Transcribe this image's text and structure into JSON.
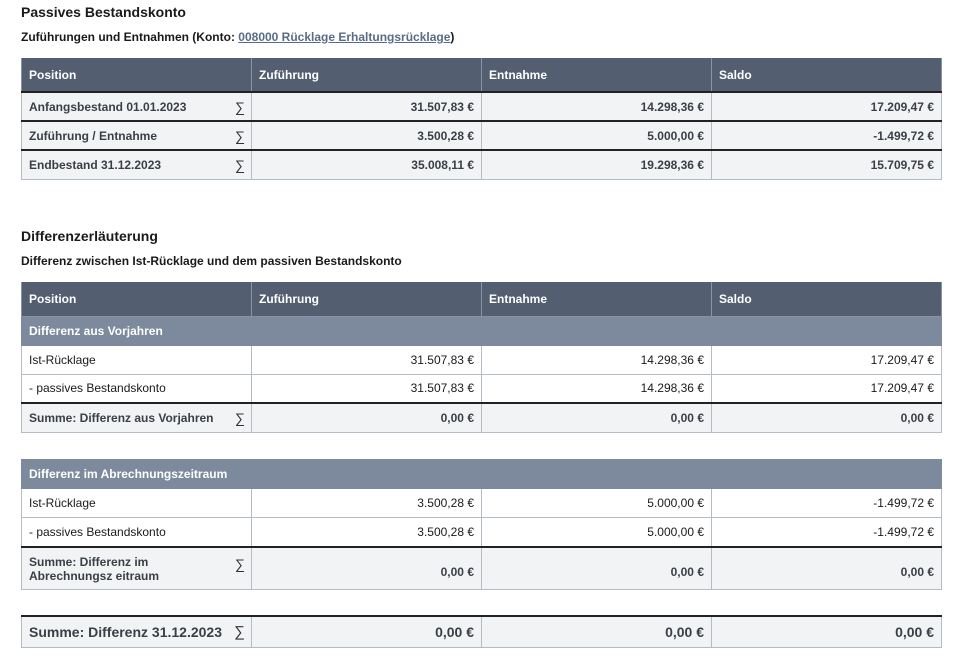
{
  "section1": {
    "title": "Passives Bestandskonto",
    "subtitle_prefix": "Zuführungen und Entnahmen (Konto: ",
    "konto_link": "008000 Rücklage Erhaltungsrücklage",
    "subtitle_suffix": ")",
    "headers": [
      "Position",
      "Zuführung",
      "Entnahme",
      "Saldo"
    ],
    "rows": [
      {
        "position": "Anfangsbestand 01.01.2023",
        "zufuehrung": "31.507,83 €",
        "entnahme": "14.298,36 €",
        "saldo": "17.209,47 €"
      },
      {
        "position": "Zuführung / Entnahme",
        "zufuehrung": "3.500,28 €",
        "entnahme": "5.000,00 €",
        "saldo": "-1.499,72 €"
      },
      {
        "position": "Endbestand 31.12.2023",
        "zufuehrung": "35.008,11 €",
        "entnahme": "19.298,36 €",
        "saldo": "15.709,75 €"
      }
    ]
  },
  "section2": {
    "title": "Differenzerläuterung",
    "subtitle": "Differenz zwischen Ist-Rücklage und dem passiven Bestandskonto",
    "headers": [
      "Position",
      "Zuführung",
      "Entnahme",
      "Saldo"
    ],
    "group1": {
      "title": "Differenz aus Vorjahren",
      "rows": [
        {
          "position": "Ist-Rücklage",
          "zufuehrung": "31.507,83 €",
          "entnahme": "14.298,36 €",
          "saldo": "17.209,47 €"
        },
        {
          "position": "- passives Bestandskonto",
          "zufuehrung": "31.507,83 €",
          "entnahme": "14.298,36 €",
          "saldo": "17.209,47 €"
        }
      ],
      "sum": {
        "position": "Summe: Differenz aus Vorjahren",
        "zufuehrung": "0,00 €",
        "entnahme": "0,00 €",
        "saldo": "0,00 €"
      }
    },
    "group2": {
      "title": "Differenz im Abrechnungszeitraum",
      "rows": [
        {
          "position": "Ist-Rücklage",
          "zufuehrung": "3.500,28 €",
          "entnahme": "5.000,00 €",
          "saldo": "-1.499,72 €"
        },
        {
          "position": "- passives Bestandskonto",
          "zufuehrung": "3.500,28 €",
          "entnahme": "5.000,00 €",
          "saldo": "-1.499,72 €"
        }
      ],
      "sum": {
        "position": "Summe: Differenz im Abrechnungsz eitraum",
        "zufuehrung": "0,00 €",
        "entnahme": "0,00 €",
        "saldo": "0,00 €"
      }
    },
    "total": {
      "position": "Summe: Differenz 31.12.2023",
      "zufuehrung": "0,00 €",
      "entnahme": "0,00 €",
      "saldo": "0,00 €"
    }
  },
  "icons": {
    "sum": "sigma-icon"
  }
}
